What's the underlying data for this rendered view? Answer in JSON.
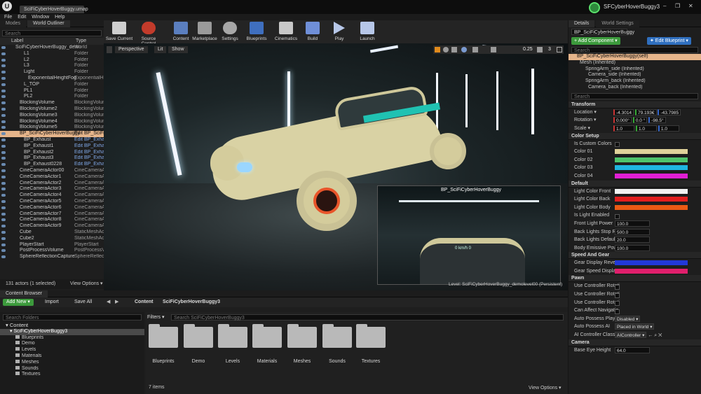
{
  "window": {
    "doc_tab": "SciFiCyberHoverBuggy.umap",
    "project_name": "SFCyberHoverBuggy3",
    "controls": [
      "–",
      "❐",
      "✕"
    ]
  },
  "menu": [
    "File",
    "Edit",
    "Window",
    "Help"
  ],
  "left": {
    "tabs": [
      "Modes",
      "World Outliner"
    ],
    "search_placeholder": "Search",
    "col_label": "Label",
    "col_type": "Type",
    "rows": [
      [
        "SciFiCyberHoverBuggy_demo",
        "World"
      ],
      [
        "L1",
        "Folder"
      ],
      [
        "L2",
        "Folder"
      ],
      [
        "L3",
        "Folder"
      ],
      [
        "Light",
        "Folder"
      ],
      [
        "ExponentialHeightFog",
        "ExponentialHe"
      ],
      [
        "L_TOP",
        "Folder"
      ],
      [
        "PL1",
        "Folder"
      ],
      [
        "PL2",
        "Folder"
      ],
      [
        "BlockingVolume",
        "BlockingVolum"
      ],
      [
        "BlockingVolume2",
        "BlockingVolum"
      ],
      [
        "BlockingVolume3",
        "BlockingVolum"
      ],
      [
        "BlockingVolume4",
        "BlockingVolum"
      ],
      [
        "BlockingVolume5",
        "BlockingVolum"
      ],
      [
        "BP_SciFiCyberHoverBuggy",
        "Edit BP_SciFi"
      ],
      [
        "BP_Exhaust",
        "Edit BP_Exha"
      ],
      [
        "BP_Exhaust1",
        "Edit BP_Exha"
      ],
      [
        "BP_Exhaust2",
        "Edit BP_Exha"
      ],
      [
        "BP_Exhaust3",
        "Edit BP_Exha"
      ],
      [
        "BP_Exhaust0228",
        "Edit BP_Exha"
      ],
      [
        "CineCameraActor00",
        "CineCameraA"
      ],
      [
        "CineCameraActor1",
        "CineCameraA"
      ],
      [
        "CineCameraActor2",
        "CineCameraA"
      ],
      [
        "CineCameraActor3",
        "CineCameraA"
      ],
      [
        "CineCameraActor4",
        "CineCameraA"
      ],
      [
        "CineCameraActor5",
        "CineCameraA"
      ],
      [
        "CineCameraActor6",
        "CineCameraA"
      ],
      [
        "CineCameraActor7",
        "CineCameraA"
      ],
      [
        "CineCameraActor8",
        "CineCameraA"
      ],
      [
        "CineCameraActor9",
        "CineCameraA"
      ],
      [
        "Cube",
        "StaticMeshAc"
      ],
      [
        "Cube2",
        "StaticMeshAc"
      ],
      [
        "PlayerStart",
        "PlayerStart"
      ],
      [
        "PostProcessVolume",
        "PostProcessV"
      ],
      [
        "SphereReflectionCapture",
        "SphereReflect"
      ]
    ],
    "footer_count": "131 actors (1 selected)",
    "view_options": "View Options ▾"
  },
  "toolbar": [
    "Save Current",
    "Source Control",
    "Content",
    "Marketplace",
    "Settings",
    "Blueprints",
    "Cinematics",
    "Build",
    "Play",
    "Launch"
  ],
  "viewport": {
    "perspective": "Perspective",
    "lit": "Lit",
    "show": "Show",
    "snap_value": "0.25",
    "cam_speed": "3",
    "preview_title": "BP_SciFiCyberHoverBuggy",
    "preview_hud": "0 km/h  0",
    "level_text": "Level:  SciFiCyberHoverBuggy_demolevel00 (Persistent)"
  },
  "content_browser": {
    "tab": "Content Browser",
    "add_new": "Add New ▾",
    "import": "Import",
    "save_all": "Save All",
    "path": [
      "Content",
      "SciFiCyberHoverBuggy3"
    ],
    "search_folders": "Search Folders",
    "filters": "Filters ▾",
    "search_asset": "Search SciFiCyberHoverBuggy3",
    "tree_root": "Content",
    "tree_selected": "SciFiCyberHoverBuggy3",
    "tree": [
      "Blueprints",
      "Demo",
      "Levels",
      "Materials",
      "Meshes",
      "Sounds",
      "Textures"
    ],
    "folders": [
      "Blueprints",
      "Demo",
      "Levels",
      "Materials",
      "Meshes",
      "Sounds",
      "Textures"
    ],
    "count": "7 items",
    "view_options": "View Options ▾"
  },
  "details": {
    "tabs": [
      "Details",
      "World Settings"
    ],
    "object_name": "BP_SciFiCyberHoverBuggy",
    "add_component": "+ Add Component ▾",
    "edit_blueprint": "✦ Edit Blueprint ▾",
    "search": "Search",
    "self": "BP_SciFiCyberHoverBuggy(self)",
    "components": [
      "Mesh (Inherited)",
      "SpringArm_side (Inherited)",
      "Camera_side (Inherited)",
      "SpringArm_back (Inherited)",
      "Camera_back (Inherited)"
    ],
    "search2": "Search",
    "transform": {
      "title": "Transform",
      "location_label": "Location ▾",
      "location": [
        "-4.3014",
        "79.193€",
        "-43.7985"
      ],
      "rotation_label": "Rotation ▾",
      "rotation": [
        "0.000°",
        "0.0 °",
        "-98.5°"
      ],
      "scale_label": "Scale ▾",
      "scale": [
        "1.0",
        "1.0",
        "1.0"
      ]
    },
    "color_setup": {
      "title": "Color Setup",
      "is_custom": "Is Custom Colors",
      "c1": "Color 01",
      "c2": "Color 02",
      "c3": "Color 03",
      "c4": "Color 04"
    },
    "default": {
      "title": "Default",
      "front": "Light Color Front",
      "back": "Light Color Back",
      "body": "Light Color Body",
      "enabled": "Is Light Enabled",
      "front_power": "Front Light Power",
      "front_power_val": "100.0",
      "stop_res": "Back Lights Stop Re",
      "stop_res_val": "500.0",
      "def_val_label": "Back Lights Default I",
      "def_val": "20.0",
      "emissive": "Body Emissive Powe",
      "emissive_val": "100.0"
    },
    "speed_gear": {
      "title": "Speed And Gear",
      "gear": "Gear Display Revers",
      "speed": "Gear Speed Display"
    },
    "pawn": {
      "title": "Pawn",
      "r1": "Use Controller Rotati",
      "r2": "Use Controller Rotati",
      "r3": "Use Controller Rotati",
      "affect": "Can Affect Navigatio",
      "auto_player": "Auto Possess Player",
      "auto_player_val": "Disabled ▾",
      "auto_ai": "Auto Possess AI",
      "auto_ai_val": "Placed in World ▾",
      "ai_class": "AI Controller Class",
      "ai_class_val": "AIController ▾"
    },
    "camera": {
      "title": "Camera",
      "eye": "Base Eye Height",
      "eye_val": "64.0"
    }
  },
  "colors": {
    "cream": "#e0d29a",
    "green": "#4fc36b",
    "cyan": "#1fb5e0",
    "magenta": "#e01fd4",
    "white": "#f2f2f2",
    "red": "#e21f1f",
    "orange": "#ec5a14",
    "blue": "#2238d8",
    "pink": "#e01f6c"
  }
}
